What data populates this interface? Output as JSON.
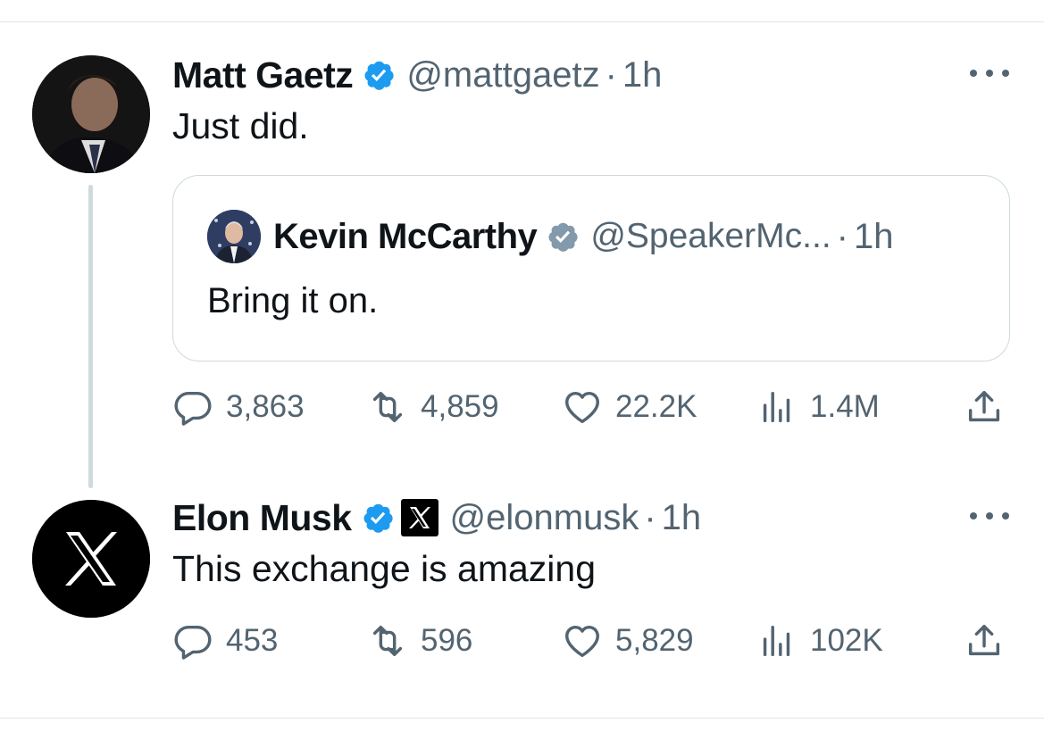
{
  "tweets": [
    {
      "author": "Matt Gaetz",
      "handle": "@mattgaetz",
      "separator": "·",
      "time": "1h",
      "text": "Just did.",
      "quote": {
        "author": "Kevin McCarthy",
        "handle": "@SpeakerMc...",
        "separator": "·",
        "time": "1h",
        "text": "Bring it on."
      },
      "stats": {
        "replies": "3,863",
        "reposts": "4,859",
        "likes": "22.2K",
        "views": "1.4M"
      }
    },
    {
      "author": "Elon Musk",
      "handle": "@elonmusk",
      "separator": "·",
      "time": "1h",
      "text": "This exchange is amazing",
      "stats": {
        "replies": "453",
        "reposts": "596",
        "likes": "5,829",
        "views": "102K"
      }
    }
  ],
  "colors": {
    "verified": "#1d9bf0",
    "affiliate_gray": "#829aab",
    "secondary_text": "#536471",
    "border": "#cfd9de"
  },
  "icons": [
    "reply-icon",
    "repost-icon",
    "like-icon",
    "views-icon",
    "share-icon",
    "more-icon",
    "verified-badge-icon",
    "x-logo-icon"
  ]
}
